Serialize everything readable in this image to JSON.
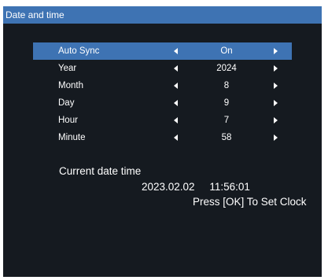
{
  "window": {
    "title": "Date and time"
  },
  "settings": [
    {
      "label": "Auto Sync",
      "value": "On",
      "selected": true
    },
    {
      "label": "Year",
      "value": "2024"
    },
    {
      "label": "Month",
      "value": "8"
    },
    {
      "label": "Day",
      "value": "9"
    },
    {
      "label": "Hour",
      "value": "7"
    },
    {
      "label": "Minute",
      "value": "58"
    }
  ],
  "current": {
    "label": "Current date time",
    "date": "2023.02.02",
    "time": "11:56:01",
    "hint": "Press [OK] To Set Clock"
  },
  "colors": {
    "accent": "#3e73b3",
    "background": "#151a20",
    "text": "#ffffff"
  },
  "icons": {
    "left_arrow": "triangle-left-icon",
    "right_arrow": "triangle-right-icon"
  }
}
